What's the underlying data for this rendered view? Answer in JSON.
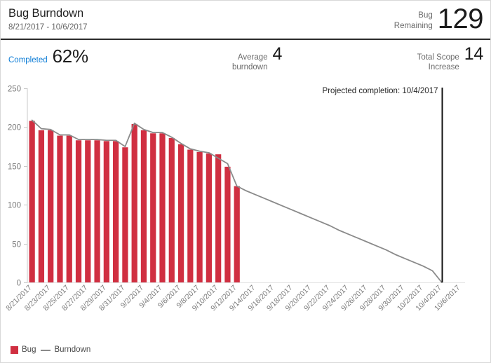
{
  "widget": {
    "title": "Bug Burndown",
    "date_range": "8/21/2017 - 10/6/2017"
  },
  "header": {
    "remaining_label_line1": "Bug",
    "remaining_label_line2": "Remaining",
    "remaining_value": "129"
  },
  "kpis": {
    "completed": {
      "label": "Completed",
      "value": "62%",
      "label_color": "#0a7bd6"
    },
    "average_burndown": {
      "label_line1": "Average",
      "label_line2": "burndown",
      "value": "4"
    },
    "total_scope_increase": {
      "label_line1": "Total Scope",
      "label_line2": "Increase",
      "value": "14"
    }
  },
  "annotation": {
    "projected_completion": "Projected completion: 10/4/2017"
  },
  "legend": [
    {
      "name": "bug",
      "label": "Bug",
      "marker": "square",
      "color": "#d02f41"
    },
    {
      "name": "burndown",
      "label": "Burndown",
      "marker": "line",
      "color": "#8a8a8a"
    }
  ],
  "colors": {
    "bar": "#d02f41",
    "line": "#8a8a8a",
    "axis": "#c8c8c8",
    "tick_text": "#7a7a7a",
    "projection_marker": "#111111",
    "link": "#0a7bd6"
  },
  "chart_data": {
    "type": "bar",
    "title": "Bug Burndown",
    "xlabel": "",
    "ylabel": "",
    "ylim": [
      0,
      250
    ],
    "yticks": [
      0,
      50,
      100,
      150,
      200,
      250
    ],
    "grid": false,
    "legend_position": "bottom-left",
    "x_tick_labels": [
      "8/21/2017",
      "8/23/2017",
      "8/25/2017",
      "8/27/2017",
      "8/29/2017",
      "8/31/2017",
      "9/2/2017",
      "9/4/2017",
      "9/6/2017",
      "9/8/2017",
      "9/10/2017",
      "9/12/2017",
      "9/14/2017",
      "9/16/2017",
      "9/18/2017",
      "9/20/2017",
      "9/22/2017",
      "9/24/2017",
      "9/26/2017",
      "9/28/2017",
      "9/30/2017",
      "10/2/2017",
      "10/4/2017",
      "10/6/2017"
    ],
    "categories": [
      "8/21/2017",
      "8/22/2017",
      "8/23/2017",
      "8/24/2017",
      "8/25/2017",
      "8/26/2017",
      "8/27/2017",
      "8/28/2017",
      "8/29/2017",
      "8/30/2017",
      "8/31/2017",
      "9/1/2017",
      "9/2/2017",
      "9/3/2017",
      "9/4/2017",
      "9/5/2017",
      "9/6/2017",
      "9/7/2017",
      "9/8/2017",
      "9/9/2017",
      "9/10/2017",
      "9/11/2017",
      "9/12/2017",
      "9/13/2017",
      "9/14/2017",
      "9/15/2017",
      "9/16/2017",
      "9/17/2017",
      "9/18/2017",
      "9/19/2017",
      "9/20/2017",
      "9/21/2017",
      "9/22/2017",
      "9/23/2017",
      "9/24/2017",
      "9/25/2017",
      "9/26/2017",
      "9/27/2017",
      "9/28/2017",
      "9/29/2017",
      "9/30/2017",
      "10/1/2017",
      "10/2/2017",
      "10/3/2017",
      "10/4/2017",
      "10/5/2017",
      "10/6/2017"
    ],
    "series": [
      {
        "name": "Bug",
        "type": "bar",
        "color": "#d02f41",
        "values": [
          208,
          196,
          196,
          189,
          189,
          183,
          183,
          183,
          182,
          182,
          174,
          204,
          196,
          192,
          192,
          186,
          178,
          171,
          168,
          166,
          165,
          149,
          124,
          null,
          null,
          null,
          null,
          null,
          null,
          null,
          null,
          null,
          null,
          null,
          null,
          null,
          null,
          null,
          null,
          null,
          null,
          null,
          null,
          null,
          null,
          null,
          null
        ]
      },
      {
        "name": "Burndown",
        "type": "line",
        "color": "#8a8a8a",
        "values": [
          209,
          198,
          197,
          190,
          190,
          184,
          184,
          184,
          183,
          183,
          175,
          205,
          197,
          193,
          193,
          187,
          179,
          172,
          169,
          167,
          160,
          153,
          124,
          118,
          113,
          108,
          103,
          98,
          93,
          88,
          83,
          78,
          73,
          67,
          62,
          57,
          52,
          47,
          42,
          36,
          31,
          26,
          21,
          15,
          0,
          null,
          null
        ]
      }
    ],
    "annotations": [
      {
        "name": "projected-completion",
        "text": "Projected completion: 10/4/2017",
        "x": "10/4/2017",
        "kind": "vertical-rule"
      }
    ],
    "notes": {
      "bar_series_last_date": "9/12/2017",
      "projection_target_value": 0
    }
  }
}
